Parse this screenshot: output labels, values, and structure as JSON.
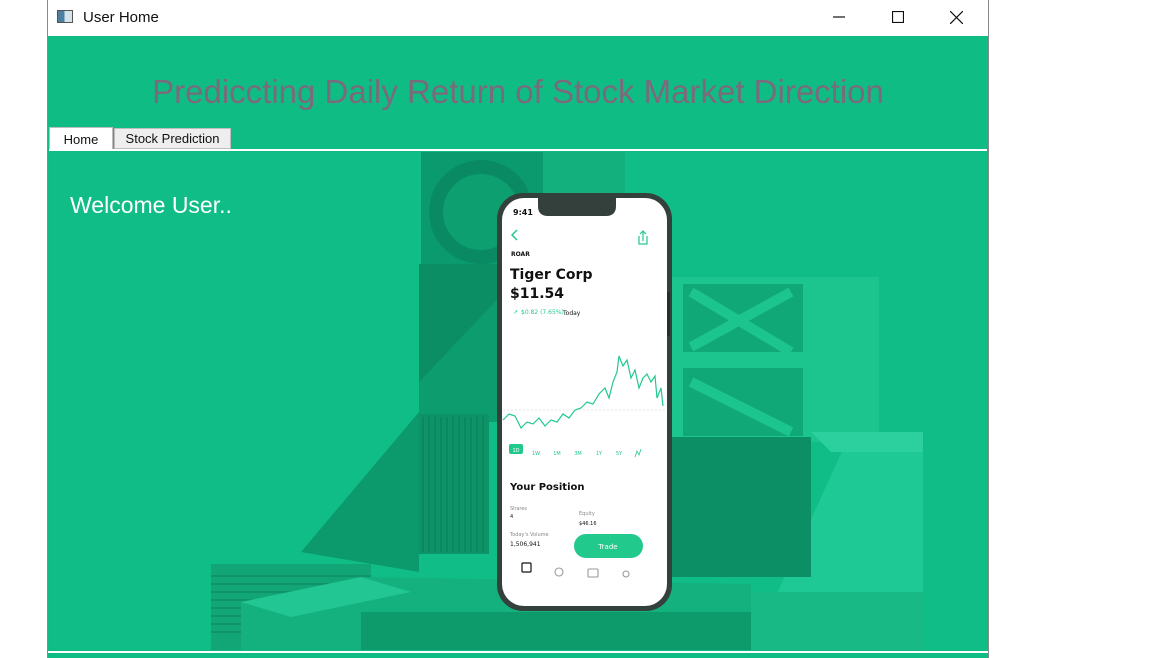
{
  "window": {
    "title": "User Home"
  },
  "header": {
    "title": "Prediccting Daily Return of Stock Market Direction"
  },
  "tabs": [
    {
      "label": "Home"
    },
    {
      "label": "Stock Prediction"
    }
  ],
  "main": {
    "welcome": "Welcome User.."
  },
  "phone": {
    "time": "9:41",
    "ticker": "ROAR",
    "company": "Tiger Corp",
    "price": "$11.54",
    "change": "$0.82 (7.65%)",
    "change_period": "Today",
    "ranges": [
      "1D",
      "1W",
      "1M",
      "3M",
      "1Y",
      "5Y"
    ],
    "position_title": "Your Position",
    "shares_label": "Shares",
    "shares_value": "4",
    "equity_label": "Equity",
    "equity_value": "$46.16",
    "volume_label": "Today's Volume",
    "volume_value": "1,506,941",
    "trade_label": "Trade"
  },
  "colors": {
    "background": "#0fbd84",
    "title_text": "#7a6a7c",
    "accent": "#21c98c"
  }
}
